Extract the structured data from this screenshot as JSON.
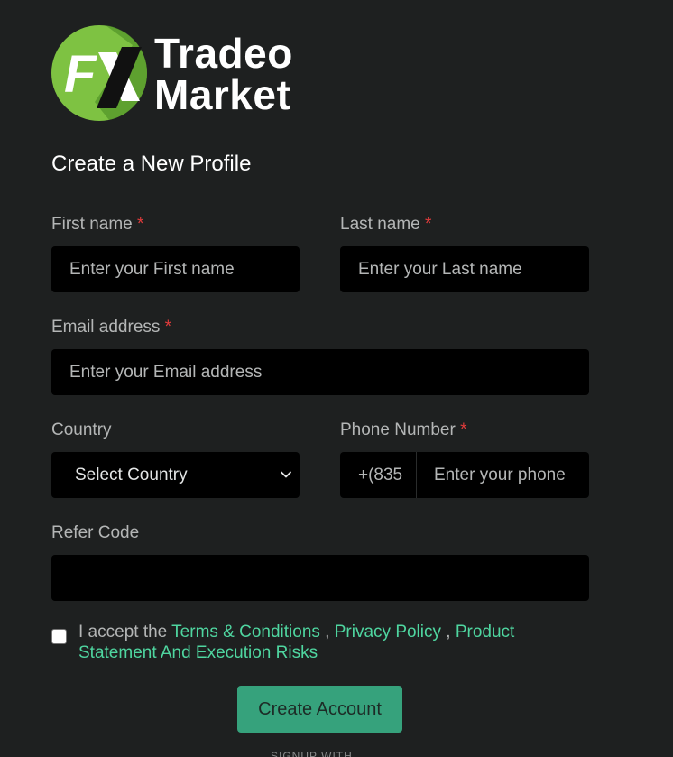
{
  "logo": {
    "mark": "FX",
    "line1": "Tradeo",
    "line2": "Market",
    "accent": "#7ec242"
  },
  "form": {
    "title": "Create a New Profile",
    "first_name": {
      "label": "First name",
      "required": "*",
      "placeholder": "Enter your First name"
    },
    "last_name": {
      "label": "Last name",
      "required": "*",
      "placeholder": "Enter your Last name"
    },
    "email": {
      "label": "Email address",
      "required": "*",
      "placeholder": "Enter your Email address"
    },
    "country": {
      "label": "Country",
      "selected": "Select Country"
    },
    "phone": {
      "label": "Phone Number",
      "required": "*",
      "dial_code": "+(835",
      "placeholder": "Enter your phone"
    },
    "refer": {
      "label": "Refer Code",
      "value": ""
    },
    "terms": {
      "prefix": "I accept the",
      "link1": "Terms & Conditions",
      "sep1": " , ",
      "link2": "Privacy Policy",
      "sep2": " , ",
      "link3": "Product Statement And Execution Risks",
      "checked": false
    },
    "submit_label": "Create Account",
    "signup_with": "SIGNUP WITH"
  },
  "colors": {
    "background": "#1e2020",
    "input": "#000000",
    "link": "#4fd6a0",
    "button": "#36a27c",
    "required": "#e03b3b"
  }
}
